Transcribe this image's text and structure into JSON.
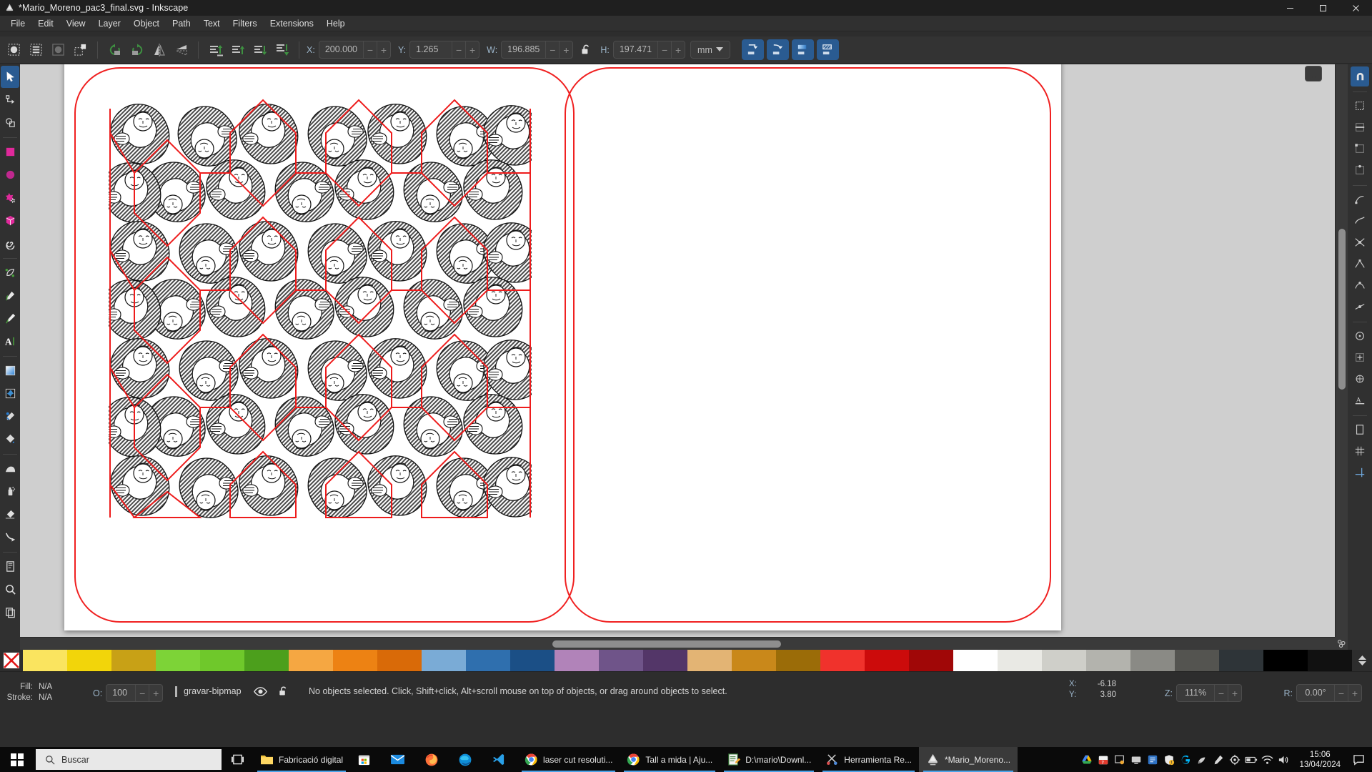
{
  "window": {
    "title": "*Mario_Moreno_pac3_final.svg - Inkscape",
    "app_icon": "inkscape-logo-icon",
    "minimize_label": "–",
    "maximize_label": "❐",
    "close_label": "✕"
  },
  "menubar": {
    "items": [
      {
        "label": "File"
      },
      {
        "label": "Edit"
      },
      {
        "label": "View"
      },
      {
        "label": "Layer"
      },
      {
        "label": "Object"
      },
      {
        "label": "Path"
      },
      {
        "label": "Text"
      },
      {
        "label": "Filters"
      },
      {
        "label": "Extensions"
      },
      {
        "label": "Help"
      }
    ]
  },
  "tool_controls": {
    "select_all_icon": "select-all-icon",
    "select_all_layers_icon": "select-all-in-all-layers-icon",
    "deselect_icon": "deselect-icon",
    "invert_selection_icon": "invert-selection-icon",
    "rotate_ccw_icon": "rotate-90-ccw-icon",
    "rotate_cw_icon": "rotate-90-cw-icon",
    "flip_horizontal_icon": "flip-horizontal-icon",
    "flip_vertical_icon": "flip-vertical-icon",
    "raise_to_top_icon": "raise-to-top-icon",
    "raise_icon": "raise-icon",
    "lower_icon": "lower-icon",
    "lower_to_bottom_icon": "lower-to-bottom-icon",
    "fields": [
      {
        "label": "X:",
        "value": "200.000",
        "name": "x-field"
      },
      {
        "label": "Y:",
        "value": "1.265",
        "name": "y-field"
      },
      {
        "label": "W:",
        "value": "196.885",
        "name": "width-field"
      },
      {
        "label": "H:",
        "value": "197.471",
        "name": "height-field"
      }
    ],
    "lock_ratio_icon": "unlocked-padlock-icon",
    "lock_ratio_state": "unlocked",
    "unit": "mm",
    "unit_dropdown_icon": "chevron-down-icon",
    "affect_buttons": [
      {
        "name": "affect-stroke-width-button",
        "icon": "scale-stroke-width-icon"
      },
      {
        "name": "affect-rounded-corners-button",
        "icon": "scale-rounded-corners-icon"
      },
      {
        "name": "affect-gradients-button",
        "icon": "move-gradients-icon"
      },
      {
        "name": "affect-patterns-button",
        "icon": "move-patterns-icon"
      }
    ],
    "minus_label": "−",
    "plus_label": "+"
  },
  "toolbox": {
    "tools": [
      {
        "name": "selector-tool",
        "icon": "arrow-pointer-icon",
        "active": true
      },
      {
        "name": "node-tool",
        "icon": "node-editor-icon",
        "active": false
      },
      {
        "name": "booleans-tool",
        "icon": "shape-builder-icon",
        "active": false
      },
      {
        "name": "rectangle-tool",
        "icon": "rectangle-icon",
        "active": false
      },
      {
        "name": "ellipse-tool",
        "icon": "ellipse-icon",
        "active": false
      },
      {
        "name": "star-tool",
        "icon": "star-icon",
        "active": false
      },
      {
        "name": "3dbox-tool",
        "icon": "cube-3d-icon",
        "active": false
      },
      {
        "name": "spiral-tool",
        "icon": "spiral-icon",
        "active": false
      },
      {
        "name": "pen-tool",
        "icon": "bezier-pen-icon",
        "active": false
      },
      {
        "name": "pencil-tool",
        "icon": "pencil-icon",
        "active": false
      },
      {
        "name": "calligraphy-tool",
        "icon": "calligraphy-brush-icon",
        "active": false
      },
      {
        "name": "text-tool",
        "icon": "text-a-icon",
        "active": false
      },
      {
        "name": "gradient-tool",
        "icon": "gradient-square-icon",
        "active": false
      },
      {
        "name": "mesh-gradient-tool",
        "icon": "mesh-gradient-icon",
        "active": false
      },
      {
        "name": "dropper-tool",
        "icon": "eyedropper-icon",
        "active": false
      },
      {
        "name": "paint-bucket-tool",
        "icon": "paint-bucket-icon",
        "active": false
      },
      {
        "name": "tweak-tool",
        "icon": "tweak-hand-icon",
        "active": false
      },
      {
        "name": "spray-tool",
        "icon": "spray-can-icon",
        "active": false
      },
      {
        "name": "eraser-tool",
        "icon": "eraser-icon",
        "active": false
      },
      {
        "name": "connector-tool",
        "icon": "connector-arrow-icon",
        "active": false
      },
      {
        "name": "pages-tool",
        "icon": "page-document-icon",
        "active": false
      },
      {
        "name": "zoom-tool",
        "icon": "magnifier-icon",
        "active": false
      },
      {
        "name": "measure-tool",
        "icon": "copies-pages-icon",
        "active": false
      }
    ]
  },
  "snapbar": {
    "buttons": [
      {
        "name": "enable-snapping-toggle",
        "icon": "snap-magnet-icon",
        "active": true
      },
      {
        "name": "snap-bounding-box-button",
        "icon": "snap-bbox-icon",
        "active": false
      },
      {
        "name": "snap-bbox-edge-button",
        "icon": "snap-bbox-edge-icon",
        "active": false
      },
      {
        "name": "snap-bbox-corner-button",
        "icon": "snap-bbox-corner-icon",
        "active": false
      },
      {
        "name": "snap-bbox-edge-midpoint-button",
        "icon": "snap-bbox-edge-mid-icon",
        "active": false
      },
      {
        "name": "snap-nodes-button",
        "icon": "snap-nodes-icon",
        "active": false
      },
      {
        "name": "snap-paths-button",
        "icon": "snap-path-icon",
        "active": false
      },
      {
        "name": "snap-path-intersection-button",
        "icon": "snap-path-intersection-icon",
        "active": false
      },
      {
        "name": "snap-cusp-nodes-button",
        "icon": "snap-cusp-node-icon",
        "active": false
      },
      {
        "name": "snap-smooth-nodes-button",
        "icon": "snap-smooth-node-icon",
        "active": false
      },
      {
        "name": "snap-line-midpoints-button",
        "icon": "snap-midpoint-icon",
        "active": false
      },
      {
        "name": "snap-others-button",
        "icon": "snap-others-icon",
        "active": false
      },
      {
        "name": "snap-object-centers-button",
        "icon": "snap-object-center-icon",
        "active": false
      },
      {
        "name": "snap-rotation-centers-button",
        "icon": "snap-rotation-center-icon",
        "active": false
      },
      {
        "name": "snap-text-baseline-button",
        "icon": "snap-text-baseline-icon",
        "active": false
      },
      {
        "name": "snap-page-border-button",
        "icon": "snap-page-border-icon",
        "active": false
      },
      {
        "name": "snap-grids-button",
        "icon": "snap-grid-icon",
        "active": false
      },
      {
        "name": "snap-guides-button",
        "icon": "snap-guide-icon",
        "active": false
      }
    ]
  },
  "canvas": {
    "document_display_icon": "display-monitor-icon",
    "zoom_fit_icon": "zoom-fit-drawing-icon",
    "shapes": [
      {
        "name": "rounded-rect-left",
        "stroke": "#f02020"
      },
      {
        "name": "rounded-rect-right",
        "stroke": "#f02020"
      }
    ],
    "artwork_name": "escher-tessellation-artwork"
  },
  "palette": {
    "no_color_icon": "no-color-x-icon",
    "scroll_up_icon": "chevron-up-icon",
    "scroll_down_icon": "chevron-down-icon",
    "menu_icon": "palette-menu-icon",
    "colors": [
      "#fae45f",
      "#f2d50a",
      "#c8a116",
      "#7dd337",
      "#6fc82b",
      "#4c9f1c",
      "#f5a742",
      "#ed8213",
      "#d96a08",
      "#7aabd6",
      "#2f6fae",
      "#1b4f86",
      "#b183b9",
      "#6f5489",
      "#533668",
      "#e3b474",
      "#c9881a",
      "#9b6c08",
      "#f0322c",
      "#cc0b0b",
      "#a00707",
      "#ffffff",
      "#e9e9e4",
      "#cfcfc9",
      "#b3b3ad",
      "#8a8a85",
      "#545450",
      "#2e3438",
      "#000000",
      "#111111"
    ]
  },
  "statusbar": {
    "fill_label": "Fill:",
    "fill_value": "N/A",
    "stroke_label": "Stroke:",
    "stroke_value": "N/A",
    "opacity_label": "O:",
    "opacity_value": "100",
    "layer_name": "gravar-bipmap",
    "layer_visibility_icon": "eye-icon",
    "layer_lock_icon": "unlocked-padlock-icon",
    "message": "No objects selected. Click, Shift+click, Alt+scroll mouse on top of objects, or drag around objects to select.",
    "cursor_x_label": "X:",
    "cursor_x_value": "-6.18",
    "cursor_y_label": "Y:",
    "cursor_y_value": "3.80",
    "zoom_label": "Z:",
    "zoom_value": "111%",
    "rotation_label": "R:",
    "rotation_value": "0.00°",
    "minus_label": "−",
    "plus_label": "+"
  },
  "taskbar": {
    "start_icon": "windows-start-icon",
    "search_icon": "search-icon",
    "search_placeholder": "Buscar",
    "task_view_icon": "task-view-icon",
    "apps": [
      {
        "label": "Fabricació digital",
        "icon": "folder-icon",
        "name": "taskbar-item-explorer",
        "running": true,
        "active": false
      },
      {
        "label": "",
        "icon": "microsoft-store-icon",
        "name": "taskbar-item-store",
        "running": false,
        "active": false
      },
      {
        "label": "",
        "icon": "mail-icon",
        "name": "taskbar-item-mail",
        "running": false,
        "active": false
      },
      {
        "label": "",
        "icon": "firefox-icon",
        "name": "taskbar-item-firefox",
        "running": false,
        "active": false
      },
      {
        "label": "",
        "icon": "edge-icon",
        "name": "taskbar-item-edge",
        "running": false,
        "active": false
      },
      {
        "label": "",
        "icon": "vscode-icon",
        "name": "taskbar-item-vscode",
        "running": false,
        "active": false
      },
      {
        "label": "laser cut resoluti...",
        "icon": "chrome-icon",
        "name": "taskbar-item-chrome-1",
        "running": true,
        "active": false
      },
      {
        "label": "Tall a mida | Aju...",
        "icon": "chrome-icon",
        "name": "taskbar-item-chrome-2",
        "running": true,
        "active": false
      },
      {
        "label": "D:\\mario\\Downl...",
        "icon": "notepad-icon",
        "name": "taskbar-item-notepad",
        "running": true,
        "active": false
      },
      {
        "label": "Herramienta Re...",
        "icon": "snipping-tool-icon",
        "name": "taskbar-item-snipping",
        "running": true,
        "active": false
      },
      {
        "label": "*Mario_Moreno...",
        "icon": "inkscape-logo-icon",
        "name": "taskbar-item-inkscape",
        "running": true,
        "active": true
      }
    ],
    "tray": [
      {
        "name": "google-drive-tray-icon",
        "icon": "drive-icon"
      },
      {
        "name": "calendar-tray-icon",
        "icon": "calendar-7-icon"
      },
      {
        "name": "photos-tray-icon",
        "icon": "photos-icon"
      },
      {
        "name": "display-tray-icon",
        "icon": "monitor-icon"
      },
      {
        "name": "network-app-tray-icon",
        "icon": "blue-app-icon"
      },
      {
        "name": "security-tray-icon",
        "icon": "shield-warning-icon"
      },
      {
        "name": "logitech-tray-icon",
        "icon": "logitech-g-icon"
      },
      {
        "name": "satellite-tray-icon",
        "icon": "satellite-icon"
      },
      {
        "name": "onenote-tray-icon",
        "icon": "pen-tablet-icon"
      },
      {
        "name": "settings-tray-icon",
        "icon": "gear-icon"
      },
      {
        "name": "battery-tray-icon",
        "icon": "battery-icon"
      },
      {
        "name": "wifi-tray-icon",
        "icon": "wifi-icon"
      },
      {
        "name": "volume-tray-icon",
        "icon": "speaker-icon"
      }
    ],
    "clock_time": "15:06",
    "clock_date": "13/04/2024",
    "notifications_icon": "notification-bubble-icon"
  }
}
